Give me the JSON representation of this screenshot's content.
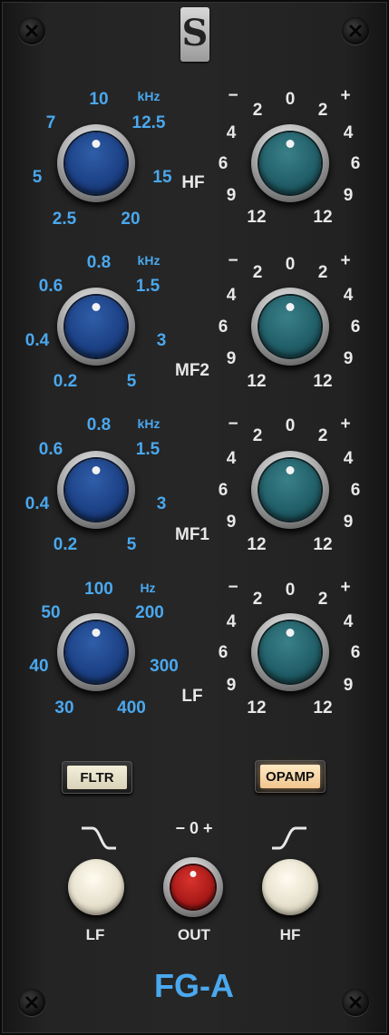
{
  "module": {
    "name": "FG-A",
    "logo_letter": "S"
  },
  "bands": [
    {
      "name": "HF",
      "unit": "kHz",
      "freq_labels": [
        "2.5",
        "5",
        "7",
        "10",
        "12.5",
        "15",
        "20"
      ],
      "gain_labels": {
        "minus": "−",
        "zero": "0",
        "plus": "+",
        "l2": "2",
        "l4": "4",
        "l6": "6",
        "l9": "9",
        "l12": "12",
        "r2": "2",
        "r4": "4",
        "r6": "6",
        "r9": "9",
        "r12": "12"
      }
    },
    {
      "name": "MF2",
      "unit": "kHz",
      "freq_labels": [
        "0.2",
        "0.4",
        "0.6",
        "0.8",
        "1.5",
        "3",
        "5"
      ],
      "gain_labels": {
        "minus": "−",
        "zero": "0",
        "plus": "+",
        "l2": "2",
        "l4": "4",
        "l6": "6",
        "l9": "9",
        "l12": "12",
        "r2": "2",
        "r4": "4",
        "r6": "6",
        "r9": "9",
        "r12": "12"
      }
    },
    {
      "name": "MF1",
      "unit": "kHz",
      "freq_labels": [
        "0.2",
        "0.4",
        "0.6",
        "0.8",
        "1.5",
        "3",
        "5"
      ],
      "gain_labels": {
        "minus": "−",
        "zero": "0",
        "plus": "+",
        "l2": "2",
        "l4": "4",
        "l6": "6",
        "l9": "9",
        "l12": "12",
        "r2": "2",
        "r4": "4",
        "r6": "6",
        "r9": "9",
        "r12": "12"
      }
    },
    {
      "name": "LF",
      "unit": "Hz",
      "freq_labels": [
        "30",
        "40",
        "50",
        "100",
        "200",
        "300",
        "400"
      ],
      "gain_labels": {
        "minus": "−",
        "zero": "0",
        "plus": "+",
        "l2": "2",
        "l4": "4",
        "l6": "6",
        "l9": "9",
        "l12": "12",
        "r2": "2",
        "r4": "4",
        "r6": "6",
        "r9": "9",
        "r12": "12"
      }
    }
  ],
  "buttons": {
    "fltr": "FLTR",
    "opamp": "OPAMP"
  },
  "bottom": {
    "lf_label": "LF",
    "out_label": "OUT",
    "hf_label": "HF",
    "out_scale": "− 0 +"
  },
  "colors": {
    "freq_text": "#4aa8ee",
    "gain_text": "#e8e8e8",
    "freq_knob": "#1d4287",
    "gain_knob": "#22606a",
    "out_knob": "#a81a18"
  }
}
